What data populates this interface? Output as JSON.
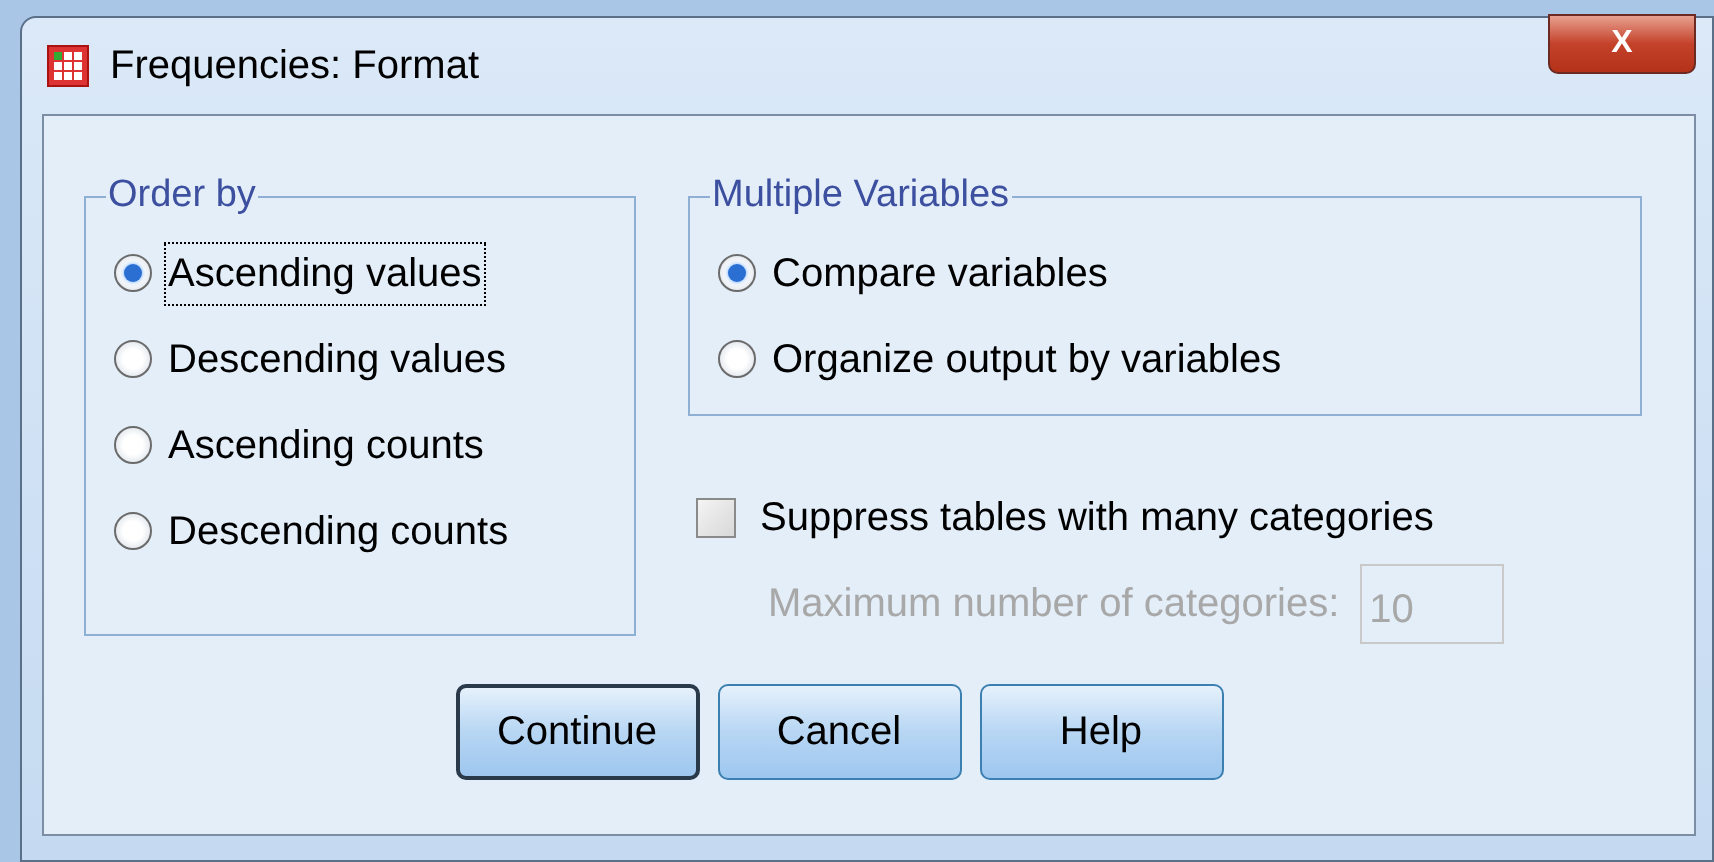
{
  "window": {
    "title": "Frequencies: Format",
    "close_label": "X"
  },
  "order_by": {
    "title": "Order by",
    "options": [
      {
        "label": "Ascending values",
        "selected": true,
        "focused": true
      },
      {
        "label": "Descending values",
        "selected": false,
        "focused": false
      },
      {
        "label": "Ascending counts",
        "selected": false,
        "focused": false
      },
      {
        "label": "Descending counts",
        "selected": false,
        "focused": false
      }
    ]
  },
  "multiple_variables": {
    "title": "Multiple Variables",
    "options": [
      {
        "label": "Compare variables",
        "selected": true
      },
      {
        "label": "Organize output by variables",
        "selected": false
      }
    ]
  },
  "suppress": {
    "label": "Suppress tables with many categories",
    "checked": false
  },
  "max_categories": {
    "label": "Maximum number of categories:",
    "value": "10",
    "disabled": true
  },
  "buttons": [
    {
      "label": "Continue",
      "default": true
    },
    {
      "label": "Cancel",
      "default": false
    },
    {
      "label": "Help",
      "default": false
    }
  ]
}
